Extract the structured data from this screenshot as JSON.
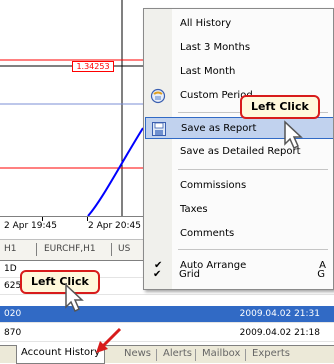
{
  "chart": {
    "price_label": "1.34253",
    "time_labels": [
      "2 Apr 19:45",
      "2 Apr 20:45"
    ],
    "line_color": "#0000ff",
    "level_color": "#ff0000"
  },
  "symbol_tabs": [
    {
      "label": "H1"
    },
    {
      "label": "EURCHF,H1"
    },
    {
      "label": "US"
    }
  ],
  "terminal": {
    "rows": [
      {
        "left": "1D",
        "right": ""
      },
      {
        "left": "625",
        "right": ""
      },
      {
        "left": "020",
        "right": "2009.04.02 21:31",
        "selected": true
      },
      {
        "left": "870",
        "right": "2009.04.02 21:18"
      }
    ]
  },
  "bottom_tabs": [
    {
      "label": "Account History",
      "active": true
    },
    {
      "label": "News"
    },
    {
      "label": "Alerts"
    },
    {
      "label": "Mailbox"
    },
    {
      "label": "Experts"
    }
  ],
  "context_menu": {
    "items": [
      {
        "label": "All History"
      },
      {
        "label": "Last 3 Months"
      },
      {
        "label": "Last Month"
      },
      {
        "label": "Custom Period...",
        "icon": "calendar-icon"
      },
      {
        "label": "Save as Report",
        "icon": "save-report-icon",
        "hover": true
      },
      {
        "label": "Save as Detailed Report"
      },
      {
        "label": "Commissions"
      },
      {
        "label": "Taxes"
      },
      {
        "label": "Comments"
      },
      {
        "label": "Auto Arrange",
        "checked": true,
        "shortcut": "A"
      },
      {
        "label": "Grid",
        "checked": true,
        "shortcut": "G"
      }
    ],
    "check_glyph": "✔",
    "hover_bg": "#c1d2ee",
    "hover_border": "#316ac5"
  },
  "callouts": {
    "top": "Left Click",
    "bottom": "Left Click"
  },
  "colors": {
    "selection": "#316ac5",
    "callout_border": "#d81b1b",
    "callout_bg": "#fff8dc",
    "arrow": "#d81b1b"
  }
}
